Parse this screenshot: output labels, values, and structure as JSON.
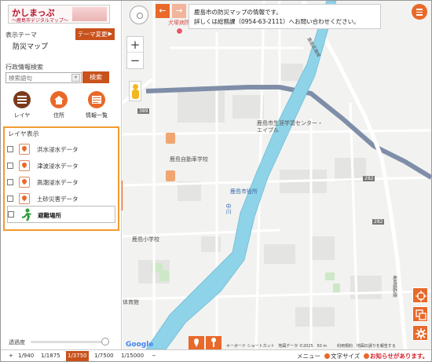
{
  "logo": {
    "title": "かしまっぷ",
    "subtitle": "～鹿島市デジタルマップ～"
  },
  "theme": {
    "label": "表示テーマ",
    "name": "防災マップ",
    "change_button": "テーマ変更",
    "change_arrow": "▶"
  },
  "search": {
    "label": "行政情報検索",
    "placeholder": "検索語句",
    "button": "検索"
  },
  "nav": [
    {
      "label": "レイヤ"
    },
    {
      "label": "住所"
    },
    {
      "label": "情報一覧"
    }
  ],
  "layers": {
    "title": "レイヤ表示",
    "items": [
      {
        "label": "洪水浸水データ",
        "checked": false
      },
      {
        "label": "津波浸水データ",
        "checked": false
      },
      {
        "label": "高潮浸水データ",
        "checked": false
      },
      {
        "label": "土砂災害データ",
        "checked": false
      },
      {
        "label": "避難場所",
        "checked": false
      }
    ]
  },
  "collapse_label": "«",
  "transparency": {
    "label": "透過度",
    "value": 1.0
  },
  "map_controls": {
    "zoom_in": "+",
    "zoom_out": "−",
    "prev": "←",
    "next": "→"
  },
  "info_box": {
    "line1": "鹿島市の防災マップの情報です。",
    "line2": "詳しくは総務課（0954-63-2111）へお問い合わせください。"
  },
  "map_labels": {
    "top_poi": "犬塚病院",
    "center": "鹿島市生涯学習センター・エイブル",
    "school1": "鹿島自動車学校",
    "city_hall": "鹿島市役所",
    "school2": "鹿島小学校",
    "gym": "体育館",
    "river": "中川",
    "route_a": "389",
    "route_b": "282",
    "route_c": "282",
    "road_name1": "鹿島武雄線",
    "road_name2": "鹿島嬉野線"
  },
  "google": "Google",
  "attribution": {
    "shortcuts": "キーボード ショートカット",
    "mapdata": "地図データ ©2025",
    "scale": "50 m",
    "terms": "利用規約",
    "report": "地図の誤りを報告する"
  },
  "scales": [
    "1/940",
    "1/1875",
    "1/3750",
    "1/7500",
    "1/15000"
  ],
  "active_scale": "1/3750",
  "bottom": {
    "plus": "+",
    "minus": "−",
    "menu": "メニュー",
    "font_size": "文字サイズ",
    "notice": "お知らせがあります。"
  },
  "colors": {
    "accent": "#e8692a",
    "button": "#c9521c",
    "river": "#8fd3e8",
    "highlight_border": "#f39b2f",
    "road_major": "#7f8ea8"
  }
}
